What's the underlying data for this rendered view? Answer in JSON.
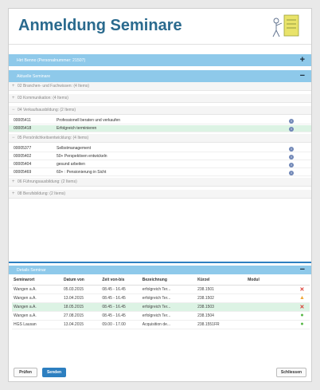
{
  "header": {
    "title": "Anmeldung Seminare"
  },
  "person_bar": {
    "label": "Hirt Benno (Personalnummer: 21507)",
    "action": "+"
  },
  "current_bar": {
    "label": "Aktuelle Seminare",
    "action": "−"
  },
  "groups": [
    {
      "label": "02 Branchen- und Fachwissen: (4 Items)",
      "toggle": "+"
    },
    {
      "label": "03 Kommunikation: (4 Items)",
      "toggle": "+"
    },
    {
      "label": "04 Verkaufsausbildung: (2 Items)",
      "toggle": "−",
      "rows": [
        {
          "code": "00005411",
          "name": "Professionell beraten und verkaufen"
        },
        {
          "code": "00005418",
          "name": "Erfolgreich terminieren"
        }
      ]
    },
    {
      "label": "05 Persönlichkeitsentwicklung: (4 Items)",
      "toggle": "−",
      "rows": [
        {
          "code": "00005377",
          "name": "Selbstmanagement"
        },
        {
          "code": "00005402",
          "name": "50+ Perspektiven entwickeln"
        },
        {
          "code": "00005404",
          "name": "gesund arbeiten"
        },
        {
          "code": "00005469",
          "name": "60+ : Pensionierung in Sicht"
        }
      ]
    },
    {
      "label": "06 Führungsausbildung: (2 Items)",
      "toggle": "+"
    },
    {
      "label": "08 Berufsbildung: (2 Items)",
      "toggle": "+"
    }
  ],
  "info_icon": "i",
  "details_bar": {
    "label": "Details Seminar",
    "action": "−"
  },
  "details": {
    "headers": [
      "Seminarort",
      "Datum von",
      "Zeit von-bis",
      "Bezeichnung",
      "Kürzel",
      "Modul"
    ],
    "rows": [
      {
        "ort": "Wangen a.A.",
        "datum": "05.03.2015",
        "zeit": "08.45 - 16.45",
        "bez": "erfolgreich Ter...",
        "kuerzel": "238.1501",
        "modul": "",
        "status": "✕",
        "status_color": "#d9352b"
      },
      {
        "ort": "Wangen a.A.",
        "datum": "13.04.2015",
        "zeit": "08.45 - 16.45",
        "bez": "erfolgreich Ter...",
        "kuerzel": "238.1502",
        "modul": "",
        "status": "▲",
        "status_color": "#f0a93a"
      },
      {
        "ort": "Wangen a.A.",
        "datum": "18.05.2015",
        "zeit": "08.45 - 16.45",
        "bez": "erfolgreich Ter...",
        "kuerzel": "238.1503",
        "modul": "",
        "status": "✕",
        "status_color": "#d9352b"
      },
      {
        "ort": "Wangen a.A.",
        "datum": "27.08.2015",
        "zeit": "08.45 - 16.45",
        "bez": "erfolgreich Ter...",
        "kuerzel": "238.1504",
        "modul": "",
        "status": "●",
        "status_color": "#58b847"
      },
      {
        "ort": "HGS Lausan",
        "datum": "13.04.2015",
        "zeit": "09.00 - 17.00",
        "bez": "Acquisition de...",
        "kuerzel": "238.1551FR",
        "modul": "",
        "status": "●",
        "status_color": "#58b847"
      }
    ]
  },
  "footer": {
    "check_label": "Prüfen",
    "send_label": "Senden",
    "close_label": "Schliessen"
  },
  "colors": {
    "accent": "#2d7fc0",
    "bar": "#8ec9ea",
    "title": "#2a6a8e",
    "highlight": "#dcf3e4"
  }
}
